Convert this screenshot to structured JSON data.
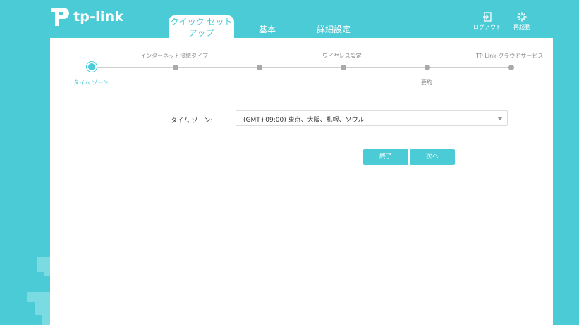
{
  "brand": {
    "logo_text": "tp-link"
  },
  "nav": {
    "tabs": [
      {
        "label_line1": "クイック セット",
        "label_line2": "アップ",
        "active": true
      },
      {
        "label": "基本"
      },
      {
        "label": "詳細設定"
      }
    ],
    "logout_label": "ログアウト",
    "reboot_label": "再起動"
  },
  "wizard": {
    "steps_top": [
      "インターネット接続タイプ",
      "ワイヤレス設定",
      "TP-Link クラウドサービス"
    ],
    "steps_bottom": [
      "タイム ゾーン",
      "要約"
    ],
    "active_step": "タイム ゾーン"
  },
  "form": {
    "timezone_label": "タイム ゾーン:",
    "timezone_value": "(GMT+09:00) 東京、大阪、札幌、ソウル"
  },
  "buttons": {
    "finish": "終了",
    "next": "次へ"
  },
  "colors": {
    "accent": "#4acbd6",
    "background": "#4acbd6",
    "panel": "#ffffff",
    "inactive_dot": "#a9a9a9"
  }
}
